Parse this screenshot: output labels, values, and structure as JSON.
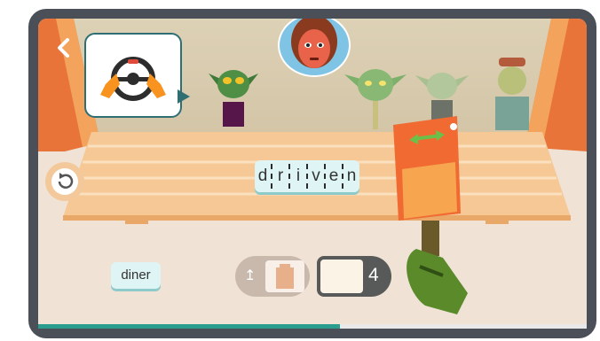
{
  "top_bar": {
    "back_icon": "chevron-left-icon"
  },
  "clue": {
    "icon": "steering-wheel-icon"
  },
  "board": {
    "letters": [
      "d",
      "r",
      "i",
      "v",
      "e",
      "n"
    ],
    "reset_icon": "undo-arrow-icon"
  },
  "bottom": {
    "word_option": "diner",
    "tray_icon": "paper-bag-icon",
    "upload_icon": "upload-arrow-icon",
    "count": "4"
  },
  "tool": {
    "drag_icon": "double-arrow-icon"
  },
  "progress": {
    "fraction": 0.55
  },
  "colors": {
    "accent": "#2a9d8f",
    "cleaver": "#f06a32",
    "tile": "#dff4f4",
    "frame": "#4b4f57"
  }
}
